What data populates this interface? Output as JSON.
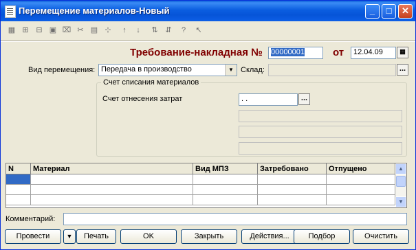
{
  "window": {
    "title": "Перемещение материалов-Новый",
    "controls": {
      "minimize": "_",
      "maximize": "□",
      "close": "✕"
    }
  },
  "toolbar": {
    "icons": [
      "table-icon",
      "add-row-icon",
      "copy-row-icon",
      "edit-row-icon",
      "delete-row-icon",
      "cut-icon",
      "paste-icon",
      "insert-icon",
      "move-up-icon",
      "move-down-icon",
      "sort-asc-icon",
      "sort-desc-icon",
      "help-icon",
      "help-cursor-icon"
    ],
    "glyphs": [
      "▦",
      "⊞",
      "⊟",
      "▣",
      "⌧",
      "✂",
      "▤",
      "⊹",
      "↑",
      "↓",
      "⇅",
      "⇵",
      "?",
      "↖"
    ]
  },
  "header": {
    "doc_title": "Требование-накладная №",
    "doc_number": "00000001",
    "date_label": "от",
    "date_value": "12.04.09"
  },
  "fields": {
    "move_type_label": "Вид перемещения:",
    "move_type_value": "Передача в производство",
    "warehouse_label": "Склад:",
    "warehouse_value": ""
  },
  "group": {
    "title": "Счет списания материалов",
    "cost_account_label": "Счет отнесения затрат",
    "cost_account_value": " .  ."
  },
  "table": {
    "columns": [
      "N",
      "Материал",
      "Вид МПЗ",
      "Затребовано",
      "Отпущено"
    ],
    "rows": [
      [
        "",
        "",
        "",
        "",
        ""
      ],
      [
        "",
        "",
        "",
        "",
        ""
      ],
      [
        "",
        "",
        "",
        "",
        ""
      ]
    ]
  },
  "comment": {
    "label": "Комментарий:",
    "value": ""
  },
  "buttons": {
    "post": "Провести",
    "dropdown": "▼",
    "print": "Печать",
    "ok": "OK",
    "close": "Закрыть",
    "actions": "Действия...",
    "select": "Подбор",
    "clear": "Очистить"
  }
}
